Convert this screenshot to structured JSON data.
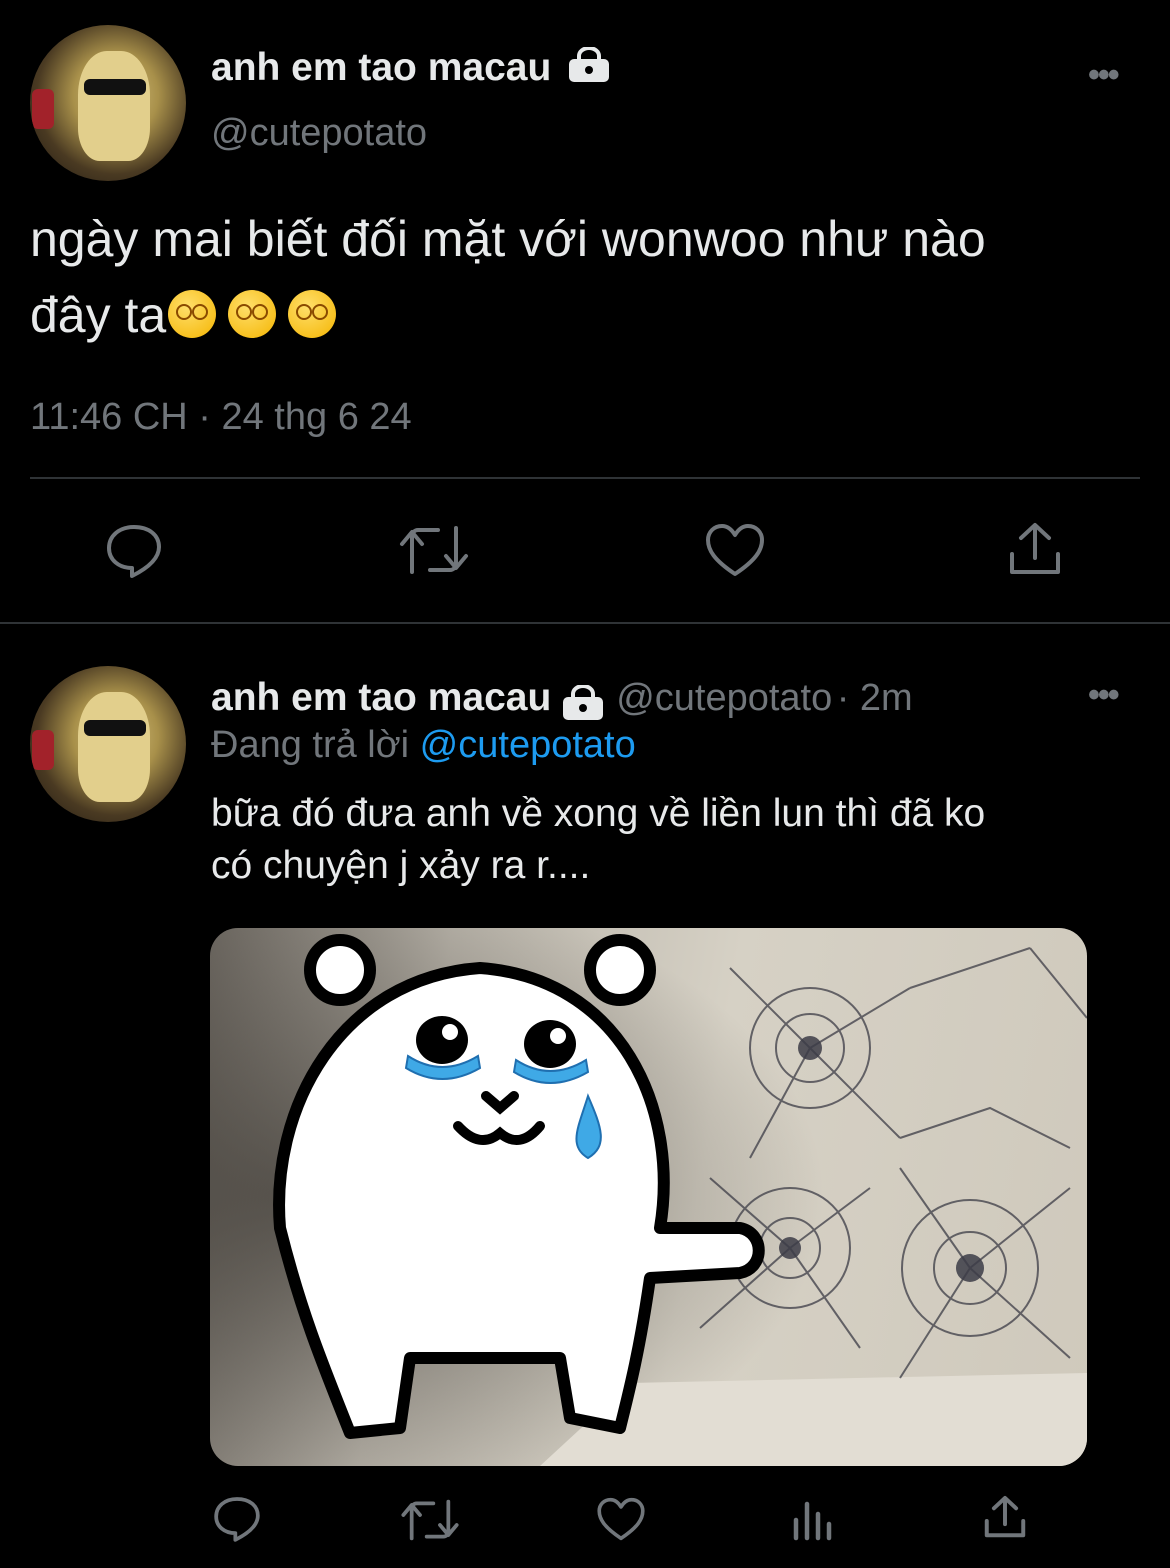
{
  "tweet": {
    "author_name": "anh em tao macau",
    "handle": "@cutepotato",
    "text_line1": "ngày mai biết đối mặt với wonwoo như nào",
    "text_line2": "đây ta",
    "emojis": [
      "face-with-spiral-eyes",
      "face-with-spiral-eyes",
      "face-with-spiral-eyes"
    ],
    "timestamp": "11:46 CH · 24 thg 6 24",
    "actions": [
      "reply-icon",
      "retweet-icon",
      "like-icon",
      "share-icon"
    ]
  },
  "reply": {
    "author_name": "anh em tao macau",
    "handle": "@cutepotato",
    "time": "· 2m",
    "replying_label": "Đang trả lời",
    "replying_to": "@cutepotato",
    "text_line1": "bữa đó đưa anh về xong về liền lun thì đã ko",
    "text_line2": "có chuyện j xảy ra r....",
    "actions": [
      "reply-icon",
      "retweet-icon",
      "like-icon",
      "views-icon",
      "share-icon"
    ]
  },
  "colors": {
    "background": "#000000",
    "text": "#e7e9ea",
    "secondary": "#71767b",
    "link": "#1d9bf0",
    "divider": "#2f3336"
  }
}
